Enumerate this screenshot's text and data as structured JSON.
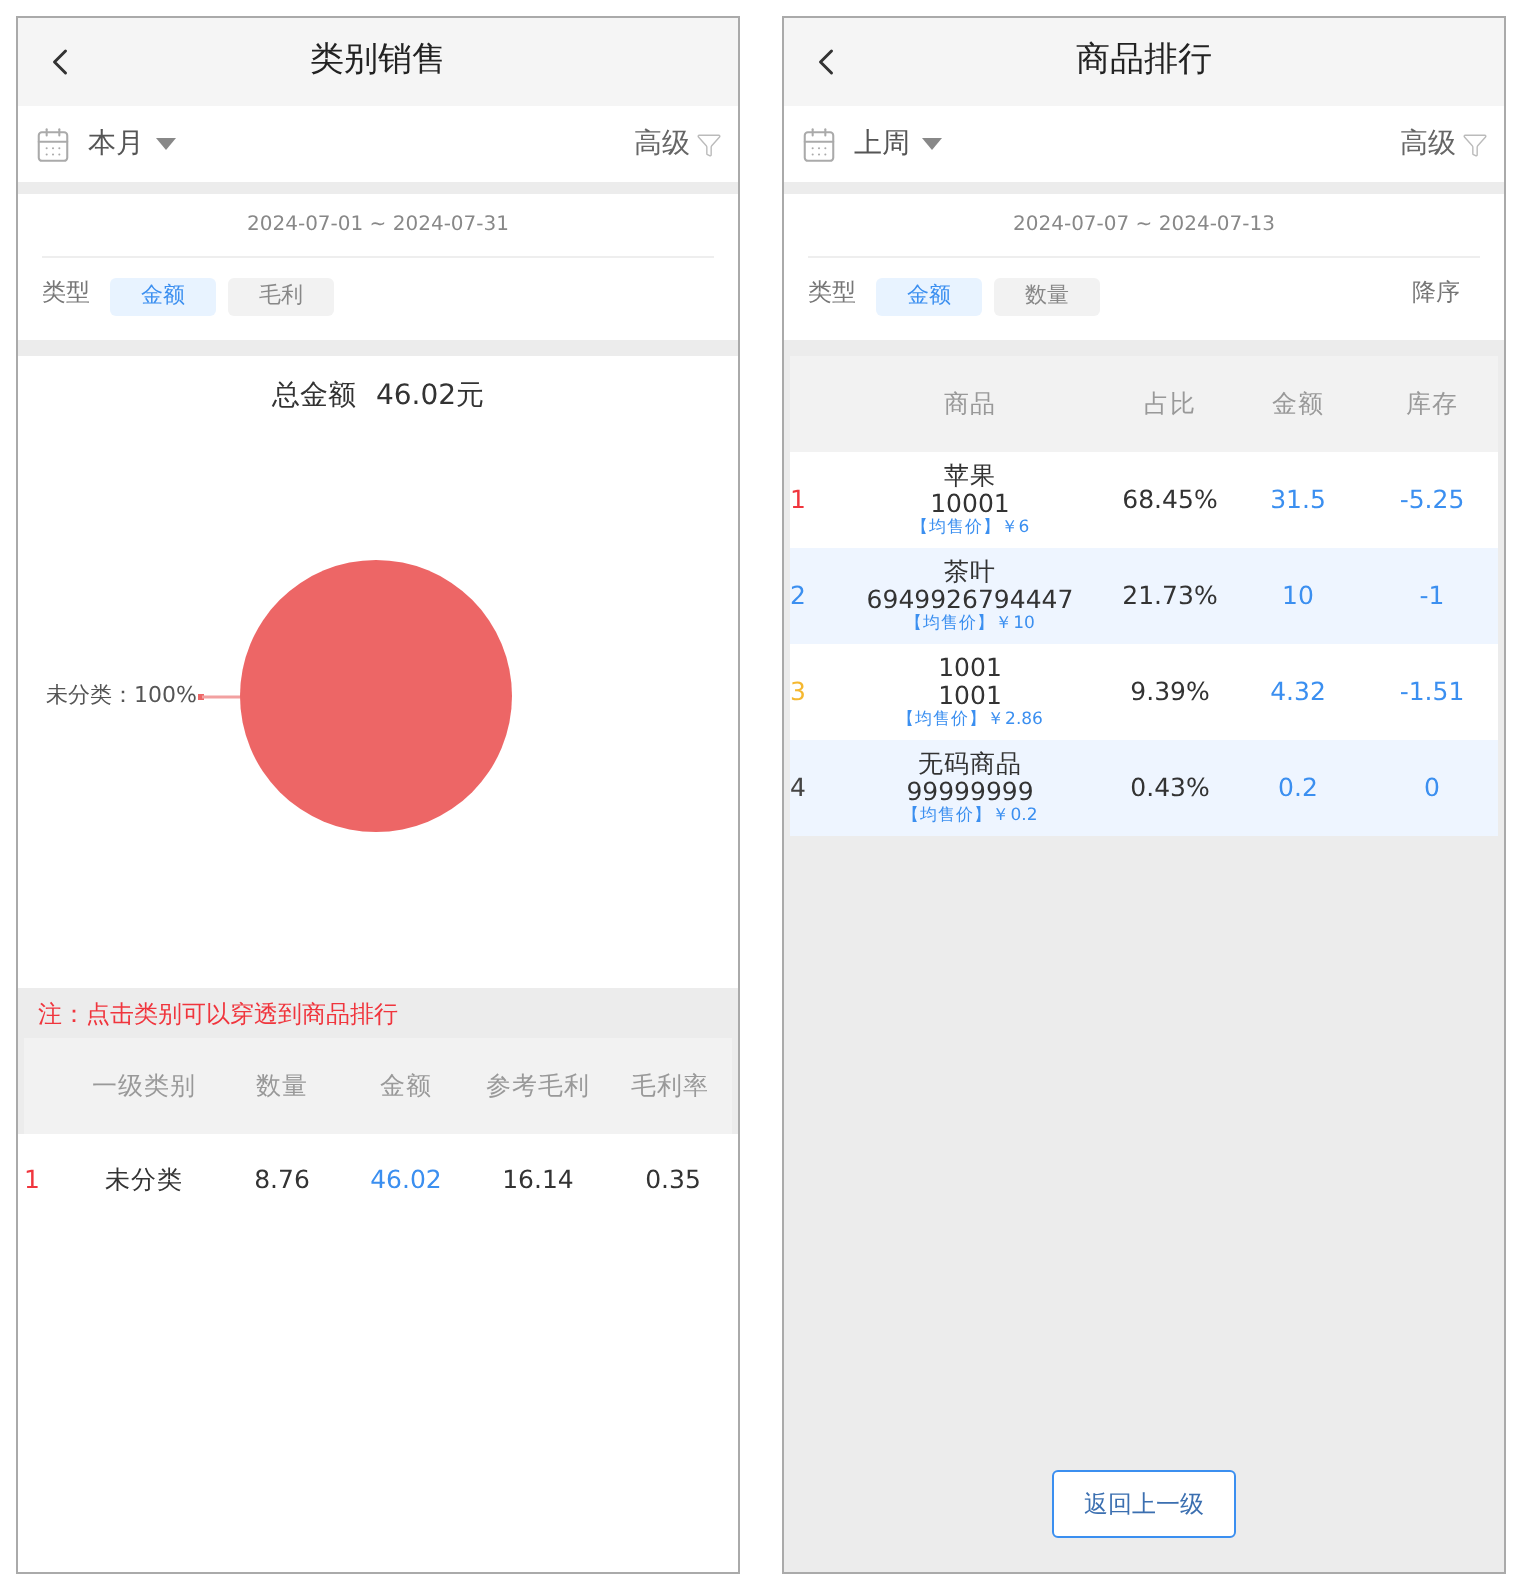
{
  "category_sales": {
    "title": "类别销售",
    "period": "本月",
    "advanced": "高级",
    "date_range": "2024-07-01 ~ 2024-07-31",
    "type_label": "类型",
    "types": [
      {
        "label": "金额",
        "selected": true
      },
      {
        "label": "毛利",
        "selected": false
      }
    ],
    "total_label": "总金额",
    "total_value": "46.02元",
    "slice_label": {
      "separator": "：",
      "unit": "%"
    },
    "chart_data": {
      "type": "pie",
      "categories": [
        "未分类"
      ],
      "values": [
        100
      ],
      "data_labels": true
    },
    "note": "注：点击类别可以穿透到商品排行",
    "columns": [
      "一级类别",
      "数量",
      "金额",
      "参考毛利",
      "毛利率"
    ],
    "rows": [
      {
        "rank": "1",
        "color": "#f0353d",
        "cells": [
          "未分类",
          "8.76",
          "46.02",
          "16.14",
          "0.35"
        ]
      }
    ]
  },
  "product_ranking": {
    "title": "商品排行",
    "period": "上周",
    "advanced": "高级",
    "date_range": "2024-07-07 ~ 2024-07-13",
    "type_label": "类型",
    "types": [
      {
        "label": "金额",
        "selected": true
      },
      {
        "label": "数量",
        "selected": false
      }
    ],
    "sort": "降序",
    "columns": [
      "商品",
      "占比",
      "金额",
      "库存"
    ],
    "rows": [
      {
        "rank": "1",
        "color": "#f0353d",
        "name": "苹果",
        "code": "10001",
        "price": "【均售价】￥6",
        "share": "68.45%",
        "amount": "31.5",
        "stock": "-5.25"
      },
      {
        "rank": "2",
        "color": "#3b8ff0",
        "name": "茶叶",
        "code": "6949926794447",
        "price": "【均售价】￥10",
        "share": "21.73%",
        "amount": "10",
        "stock": "-1"
      },
      {
        "rank": "3",
        "color": "#f5b830",
        "name": "1001",
        "code": "1001",
        "price": "【均售价】￥2.86",
        "share": "9.39%",
        "amount": "4.32",
        "stock": "-1.51"
      },
      {
        "rank": "4",
        "color": "#444444",
        "name": "无码商品",
        "code": "99999999",
        "price": "【均售价】￥0.2",
        "share": "0.43%",
        "amount": "0.2",
        "stock": "0"
      }
    ],
    "back_button": "返回上一级"
  }
}
